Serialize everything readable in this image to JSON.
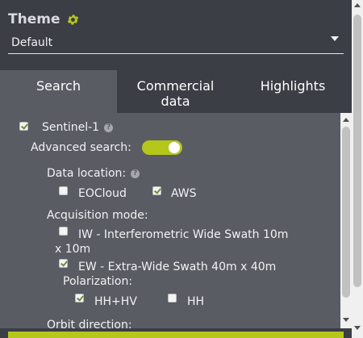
{
  "theme": {
    "title": "Theme",
    "selected": "Default",
    "accent_color": "#b5c71a"
  },
  "tabs": [
    {
      "label": "Search",
      "active": true
    },
    {
      "label": "Commercial\ndata",
      "active": false
    },
    {
      "label": "Highlights",
      "active": false
    }
  ],
  "search": {
    "sentinel1": {
      "label": "Sentinel-1",
      "checked": true
    },
    "advanced_search": {
      "label": "Advanced search:",
      "enabled": true
    },
    "data_location": {
      "label": "Data location:",
      "options": [
        {
          "label": "EOCloud",
          "checked": false
        },
        {
          "label": "AWS",
          "checked": true
        }
      ]
    },
    "acquisition_mode": {
      "label": "Acquisition mode:",
      "iw": {
        "label_line1": "IW - Interferometric Wide Swath 10m",
        "label_line2": "x 10m",
        "checked": false
      },
      "ew": {
        "label": "EW - Extra-Wide Swath 40m x 40m",
        "checked": true
      }
    },
    "polarization": {
      "label": "Polarization:",
      "options": [
        {
          "label": "HH+HV",
          "checked": true
        },
        {
          "label": "HH",
          "checked": false
        }
      ]
    },
    "orbit_direction": {
      "label": "Orbit direction:"
    }
  },
  "icons": {
    "gear": "gear-icon",
    "help": "help-icon",
    "dropdown": "chevron-down-icon"
  }
}
